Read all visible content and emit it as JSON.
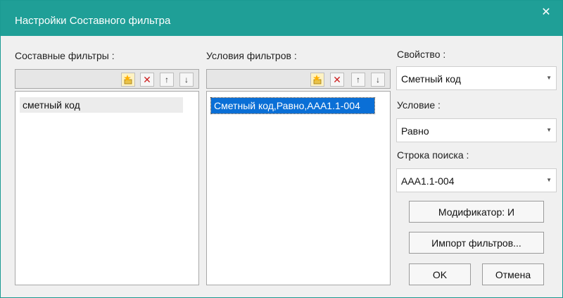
{
  "dialog": {
    "title": "Настройки Составного фильтра",
    "close_icon": "close-icon"
  },
  "left_panel": {
    "label": "Составные фильтры :",
    "items": [
      "сметный код"
    ]
  },
  "middle_panel": {
    "label": "Условия фильтров :",
    "items": [
      "Сметный код,Равно,AAA1.1-004"
    ]
  },
  "right_panel": {
    "property_label": "Свойство :",
    "property_value": "Сметный код",
    "condition_label": "Условие :",
    "condition_value": "Равно",
    "search_label": "Строка поиска :",
    "search_value": "AAA1.1-004",
    "modifier_button": "Модификатор: И",
    "import_button": "Импорт фильтров...",
    "ok_button": "OK",
    "cancel_button": "Отмена"
  },
  "colors": {
    "titlebar": "#1f9f97",
    "selection": "#0a6fd6",
    "delete_icon": "#cc1f1f",
    "add_icon_bg": "#fff2c2"
  },
  "icons": {
    "add": "star-add-icon",
    "delete": "delete-x-icon",
    "up": "arrow-up-icon",
    "down": "arrow-down-icon",
    "dropdown": "chevron-down-icon"
  }
}
